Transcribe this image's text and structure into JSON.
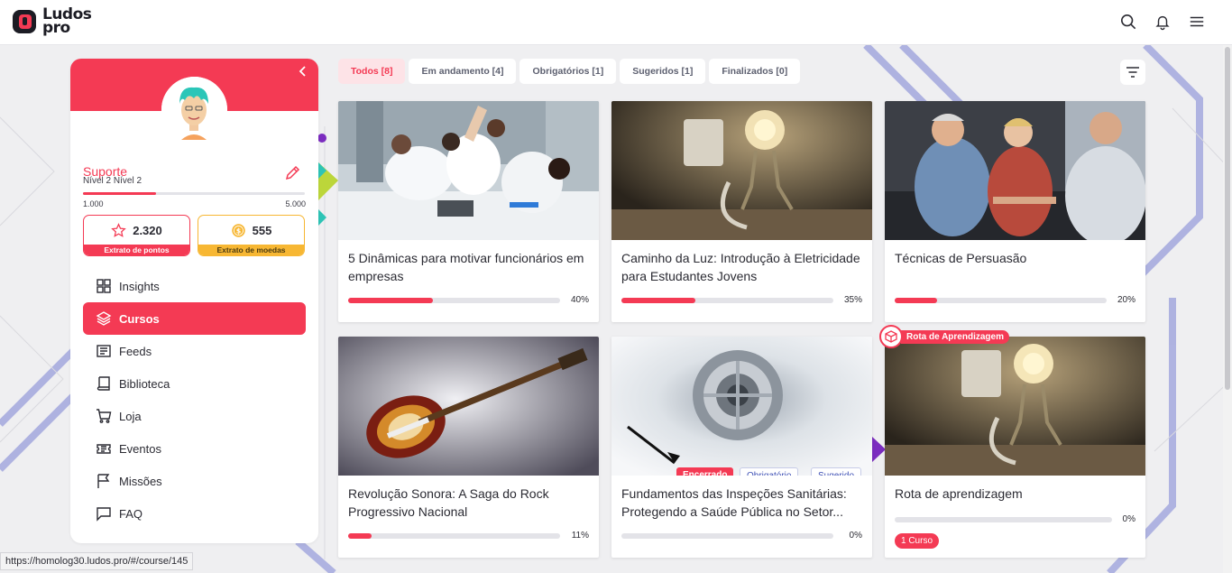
{
  "app": {
    "logo_line1": "Ludos",
    "logo_line2": "pro",
    "brand_color": "#f43a54"
  },
  "header": {
    "icons": [
      "search-icon",
      "bell-icon",
      "menu-icon"
    ]
  },
  "profile": {
    "name": "Suporte",
    "level": "Nível 2 Nível 2",
    "xp_min": "1.000",
    "xp_max": "5.000",
    "xp_progress": 0.33,
    "points_value": "2.320",
    "points_label": "Extrato de pontos",
    "coins_value": "555",
    "coins_label": "Extrato de moedas"
  },
  "nav": {
    "items": [
      {
        "label": "Insights",
        "icon": "grid-icon",
        "active": false
      },
      {
        "label": "Cursos",
        "icon": "layers-icon",
        "active": true
      },
      {
        "label": "Feeds",
        "icon": "newspaper-icon",
        "active": false
      },
      {
        "label": "Biblioteca",
        "icon": "book-icon",
        "active": false
      },
      {
        "label": "Loja",
        "icon": "cart-icon",
        "active": false
      },
      {
        "label": "Eventos",
        "icon": "ticket-icon",
        "active": false
      },
      {
        "label": "Missões",
        "icon": "flag-icon",
        "active": false
      },
      {
        "label": "FAQ",
        "icon": "chat-icon",
        "active": false
      }
    ]
  },
  "tabs": [
    {
      "label": "Todos [8]",
      "active": true
    },
    {
      "label": "Em andamento [4]",
      "active": false
    },
    {
      "label": "Obrigatórios [1]",
      "active": false
    },
    {
      "label": "Sugeridos [1]",
      "active": false
    },
    {
      "label": "Finalizados [0]",
      "active": false
    }
  ],
  "courses": [
    {
      "title": "5 Dinâmicas para motivar funcionários em empresas",
      "progress": 40,
      "progress_label": "40%",
      "image": "team-high-five-photo"
    },
    {
      "title": "Caminho da Luz: Introdução à Eletricidade para Estudantes Jovens",
      "progress": 35,
      "progress_label": "35%",
      "image": "lightbulb-figure-photo"
    },
    {
      "title": "Técnicas de Persuasão",
      "progress": 20,
      "progress_label": "20%",
      "image": "business-handshake-photo"
    },
    {
      "title": "Revolução Sonora: A Saga do Rock Progressivo Nacional",
      "progress": 11,
      "progress_label": "11%",
      "image": "electric-guitar-photo"
    },
    {
      "title": "Fundamentos das Inspeções Sanitárias: Protegendo a Saúde Pública no Setor...",
      "progress": 0,
      "progress_label": "0%",
      "image": "drain-photo",
      "badges": [
        "Encerrado",
        "Obrigatório",
        "Sugerido"
      ]
    },
    {
      "title": "Rota de aprendizagem",
      "progress": 0,
      "progress_label": "0%",
      "image": "lightbulb-figure-photo",
      "tag": "Rota de Aprendizagem",
      "pill": "1 Curso"
    }
  ],
  "status_bar": {
    "url": "https://homolog30.ludos.pro/#/course/145"
  }
}
